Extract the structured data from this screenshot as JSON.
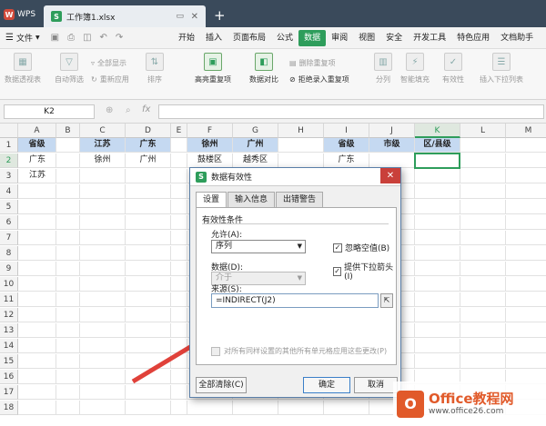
{
  "titlebar": {
    "app": "WPS",
    "file_tab": "工作簿1.xlsx"
  },
  "menubar": {
    "file": "文件",
    "tabs": [
      "开始",
      "插入",
      "页面布局",
      "公式",
      "数据",
      "审阅",
      "视图",
      "安全",
      "开发工具",
      "特色应用",
      "文档助手"
    ],
    "active_tab": "数据"
  },
  "ribbon": {
    "pivot": "数据透视表",
    "autofilter": "自动筛选",
    "show_all": "全部显示",
    "reapply": "重新应用",
    "sort": "排序",
    "highlight_dup": "高亮重复项",
    "compare": "数据对比",
    "delete_dup": "删除重复项",
    "reject_dup": "拒绝录入重复项",
    "split": "分列",
    "smart_fill": "智能填充",
    "validity": "有效性",
    "insert_dropdown": "插入下拉列表"
  },
  "formula_bar": {
    "cell_ref": "K2",
    "fx": "fx",
    "value": ""
  },
  "sheet": {
    "columns": [
      "A",
      "B",
      "C",
      "D",
      "E",
      "F",
      "G",
      "H",
      "I",
      "J",
      "K",
      "L",
      "M"
    ],
    "selected_column": "K",
    "rows": [
      "1",
      "2",
      "3",
      "4",
      "5",
      "6",
      "7",
      "8",
      "9",
      "10",
      "11",
      "12",
      "13",
      "14",
      "15",
      "16",
      "17",
      "18"
    ],
    "selected_row": "2",
    "cells": {
      "A1": "省级",
      "A2": "广东",
      "A3": "江苏",
      "C1": "江苏",
      "C2": "徐州",
      "D1": "广东",
      "D2": "广州",
      "F1": "徐州",
      "F2": "鼓楼区",
      "G1": "广州",
      "G2": "越秀区",
      "I1": "省级",
      "I2": "广东",
      "J1": "市级",
      "K1": "区/县级"
    }
  },
  "dialog": {
    "title": "数据有效性",
    "tabs": [
      "设置",
      "输入信息",
      "出错警告"
    ],
    "active_tab": "设置",
    "group_label": "有效性条件",
    "allow_label": "允许(A):",
    "allow_value": "序列",
    "data_label": "数据(D):",
    "data_value": "介于",
    "ignore_blank": "忽略空值(B)",
    "ignore_blank_checked": true,
    "dropdown": "提供下拉箭头(I)",
    "dropdown_checked": true,
    "source_label": "来源(S):",
    "source_value": "=INDIRECT(J2)",
    "apply_all": "对所有同样设置的其他所有单元格应用这些更改(P)",
    "clear_all": "全部清除(C)",
    "ok": "确定",
    "cancel": "取消"
  },
  "watermark": {
    "brand": "Office教程网",
    "url": "www.office26.com",
    "logo": "O"
  },
  "colors": {
    "accent": "#2e9d5b",
    "header_fill": "#c5d9f1",
    "arrow": "#e0413a",
    "watermark": "#e15a2a"
  }
}
